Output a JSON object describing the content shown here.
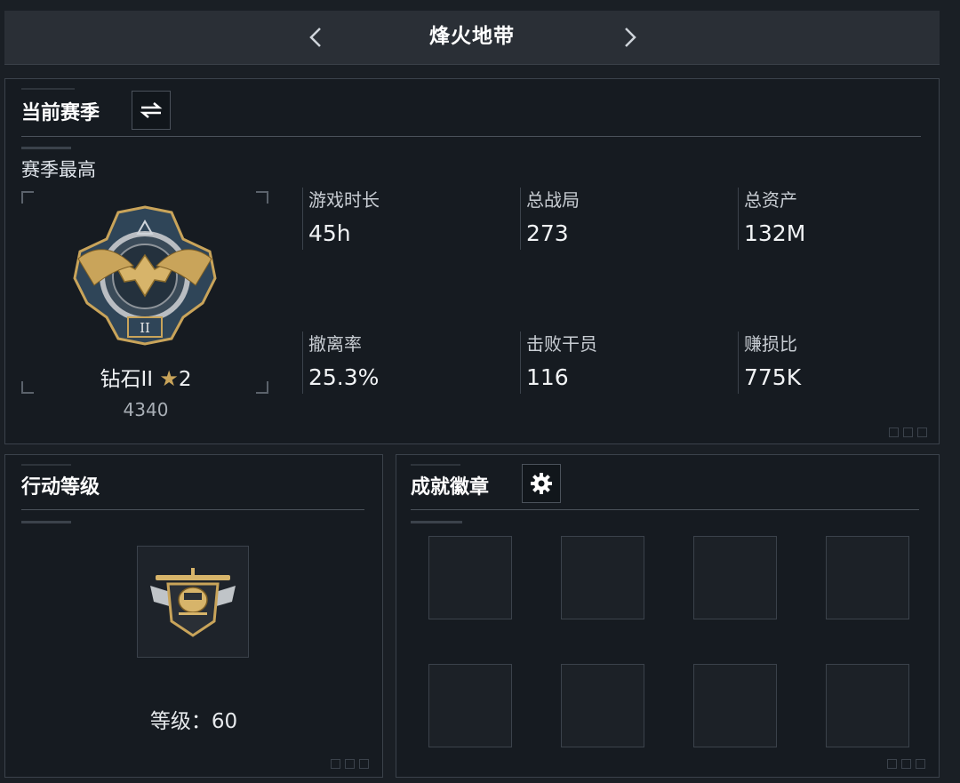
{
  "header": {
    "title": "烽火地带"
  },
  "season": {
    "heading": "当前赛季",
    "subheading": "赛季最高",
    "rank": {
      "name": "钻石II",
      "stars": "2",
      "score": "4340"
    },
    "stats": [
      {
        "label": "游戏时长",
        "value": "45h"
      },
      {
        "label": "总战局",
        "value": "273"
      },
      {
        "label": "总资产",
        "value": "132M"
      },
      {
        "label": "撤离率",
        "value": "25.3%"
      },
      {
        "label": "击败干员",
        "value": "116"
      },
      {
        "label": "赚损比",
        "value": "775K"
      }
    ]
  },
  "action_level": {
    "heading": "行动等级",
    "level_label": "等级：",
    "level_value": "60"
  },
  "badges": {
    "heading": "成就徽章",
    "slots": 8
  },
  "colors": {
    "gold": "#c9a45a",
    "panel_border": "#3b424b",
    "accent_white": "#ffffff"
  },
  "icons": [
    "chevron-left-icon",
    "chevron-right-icon",
    "swap-icon",
    "gear-icon",
    "star-icon",
    "rank-emblem",
    "level-emblem"
  ]
}
